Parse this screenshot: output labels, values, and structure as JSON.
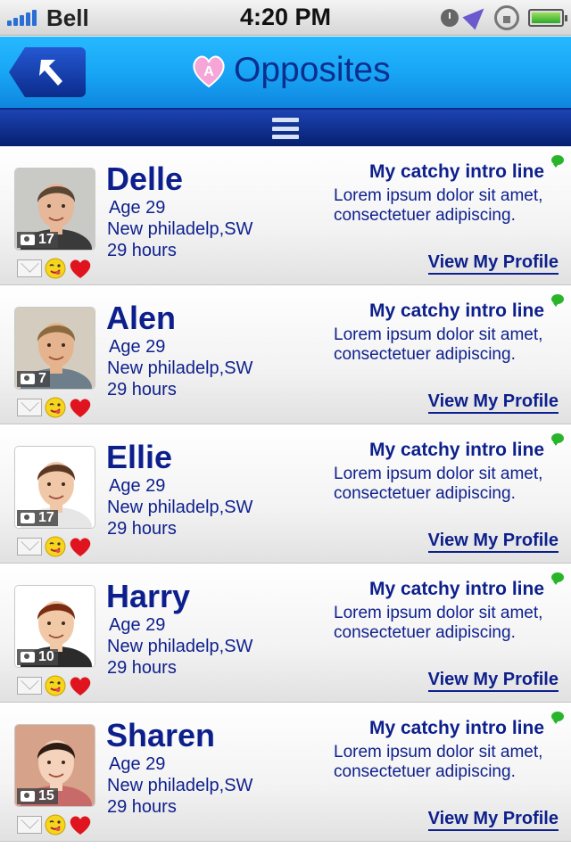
{
  "status_bar": {
    "carrier": "Bell",
    "time": "4:20 PM",
    "icons": [
      "signal-bars-icon",
      "clock-icon",
      "location-arrow-icon",
      "rotation-lock-icon",
      "battery-icon"
    ]
  },
  "header": {
    "title": "Opposites",
    "back_icon": "back-arrow-icon",
    "logo_icon": "heart-logo-icon"
  },
  "menu_bar": {
    "icon": "menu-lines-icon"
  },
  "colors": {
    "header_blue": "#18a6f5",
    "menu_dark_blue": "#0b2c8c",
    "text_navy": "#0d1f8c",
    "heart_red": "#e0141e",
    "online_green": "#29b529"
  },
  "profiles": [
    {
      "name": "Delle",
      "age": "Age 29",
      "location": "New philadelp,SW",
      "last_seen": "29 hours",
      "photo_count": "17",
      "intro_title": "My catchy intro line",
      "intro_text": "Lorem ipsum dolor sit amet, consectetuer adipiscing.",
      "link": "View My Profile"
    },
    {
      "name": "Alen",
      "age": "Age 29",
      "location": "New philadelp,SW",
      "last_seen": "29 hours",
      "photo_count": "7",
      "intro_title": "My catchy intro line",
      "intro_text": "Lorem ipsum dolor sit amet, consectetuer adipiscing.",
      "link": "View My Profile"
    },
    {
      "name": "Ellie",
      "age": "Age 29",
      "location": "New philadelp,SW",
      "last_seen": "29 hours",
      "photo_count": "17",
      "intro_title": "My catchy intro line",
      "intro_text": "Lorem ipsum dolor sit amet, consectetuer adipiscing.",
      "link": "View My Profile"
    },
    {
      "name": "Harry",
      "age": "Age 29",
      "location": "New philadelp,SW",
      "last_seen": "29 hours",
      "photo_count": "10",
      "intro_title": "My catchy intro line",
      "intro_text": "Lorem ipsum dolor sit amet, consectetuer adipiscing.",
      "link": "View My Profile"
    },
    {
      "name": "Sharen",
      "age": "Age 29",
      "location": "New philadelp,SW",
      "last_seen": "29 hours",
      "photo_count": "15",
      "intro_title": "My catchy intro line",
      "intro_text": "Lorem ipsum dolor sit amet, consectetuer adipiscing.",
      "link": "View My Profile"
    }
  ]
}
